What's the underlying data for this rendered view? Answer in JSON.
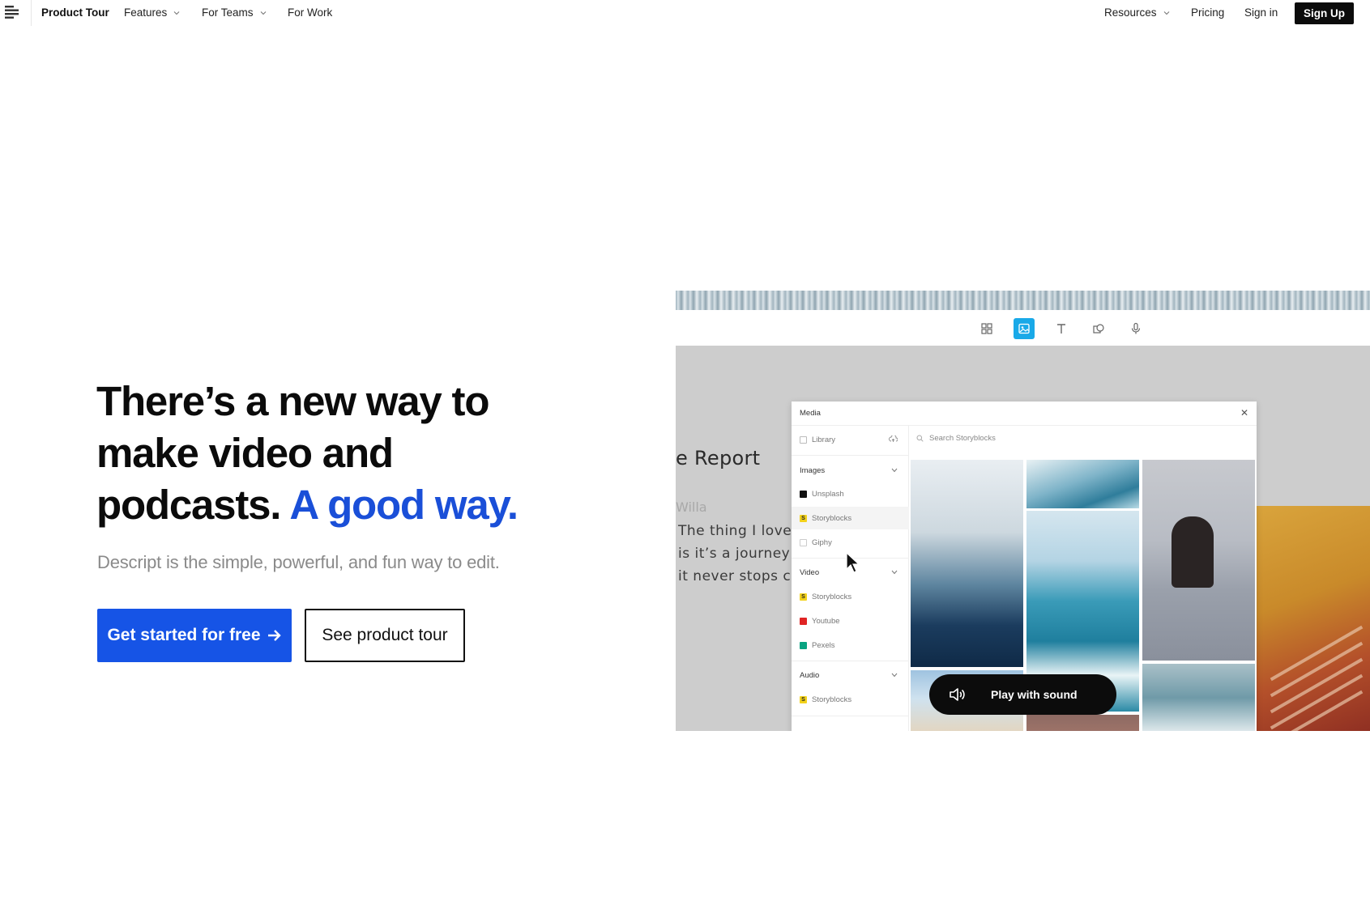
{
  "nav": {
    "logo_icon": "descript-logo-icon",
    "left_items": [
      {
        "label": "Product Tour",
        "has_dropdown": false
      },
      {
        "label": "Features",
        "has_dropdown": true
      },
      {
        "label": "For Teams",
        "has_dropdown": true
      },
      {
        "label": "For Work",
        "has_dropdown": false
      }
    ],
    "right_items": [
      {
        "label": "Resources",
        "has_dropdown": true
      },
      {
        "label": "Pricing",
        "has_dropdown": false
      },
      {
        "label": "Sign in",
        "has_dropdown": false
      }
    ],
    "signup_label": "Sign Up"
  },
  "hero": {
    "headline_line1": "There’s a new way to",
    "headline_line2": "make video and",
    "headline_line3": "podcasts.",
    "headline_accent": "A good way.",
    "subhead": "Descript is the simple, powerful, and fun way to edit.",
    "cta_primary": "Get started for free",
    "cta_primary_icon": "arrow-right-icon",
    "cta_secondary": "See product tour"
  },
  "video": {
    "toolbar_icons": [
      "grid-icon",
      "image-icon",
      "text-icon",
      "shapes-icon",
      "microphone-icon"
    ],
    "active_tool": "image-icon",
    "doc": {
      "title": "e Report",
      "author": "Willa",
      "lines": [
        "The thing I love",
        "is it’s a journey",
        "it never stops ch"
      ]
    },
    "media_panel": {
      "title": "Media",
      "library_label": "Library",
      "search_placeholder": "Search Storyblocks",
      "sections": [
        {
          "label": "Images",
          "sources": [
            "Unsplash",
            "Storyblocks",
            "Giphy"
          ]
        },
        {
          "label": "Video",
          "sources": [
            "Storyblocks",
            "Youtube",
            "Pexels"
          ]
        },
        {
          "label": "Audio",
          "sources": [
            "Storyblocks"
          ]
        }
      ]
    },
    "play_label": "Play with sound",
    "play_icon": "speaker-icon"
  },
  "colors": {
    "accent_blue": "#1654e6",
    "headline_accent": "#1a4fd8",
    "active_tool": "#19a9e8",
    "dark": "#0b0b0b"
  }
}
